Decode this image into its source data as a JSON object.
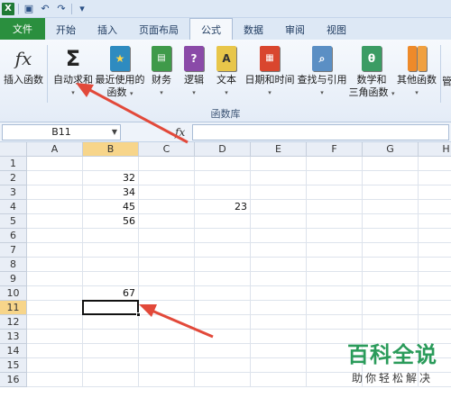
{
  "colors": {
    "file_tab": "#2a8f3e",
    "selected_header": "#f7d58a",
    "arrow": "#e2493a",
    "watermark": "#2a9b5a"
  },
  "tabs": [
    "文件",
    "开始",
    "插入",
    "页面布局",
    "公式",
    "数据",
    "审阅",
    "视图"
  ],
  "active_tab": "公式",
  "ribbon": {
    "insert_function": "插入函数",
    "autosum": "自动求和",
    "recent_l1": "最近使用的",
    "recent_l2": "函数",
    "financial": "财务",
    "logical": "逻辑",
    "text": "文本",
    "datetime": "日期和时间",
    "lookup": "查找与引用",
    "math_l1": "数学和",
    "math_l2": "三角函数",
    "more": "其他函数",
    "cut_label": "管",
    "group": "函数库",
    "icons": {
      "insert": "fx",
      "sum": "Σ",
      "logical": "?",
      "text": "A",
      "math": "θ"
    }
  },
  "formula_bar": {
    "name_box": "B11",
    "fx": "fx",
    "value": ""
  },
  "columns": [
    "A",
    "B",
    "C",
    "D",
    "E",
    "F",
    "G",
    "H"
  ],
  "selected_column": "B",
  "rows": [
    "1",
    "2",
    "3",
    "4",
    "5",
    "6",
    "7",
    "8",
    "9",
    "10",
    "11",
    "12",
    "13",
    "14",
    "15",
    "16"
  ],
  "selected_row": "11",
  "cells": {
    "B2": "32",
    "B3": "34",
    "B4": "45",
    "B5": "56",
    "D4": "23",
    "B10": "67"
  },
  "watermark": {
    "line1": "百科全说",
    "line2": "助你轻松解决"
  }
}
